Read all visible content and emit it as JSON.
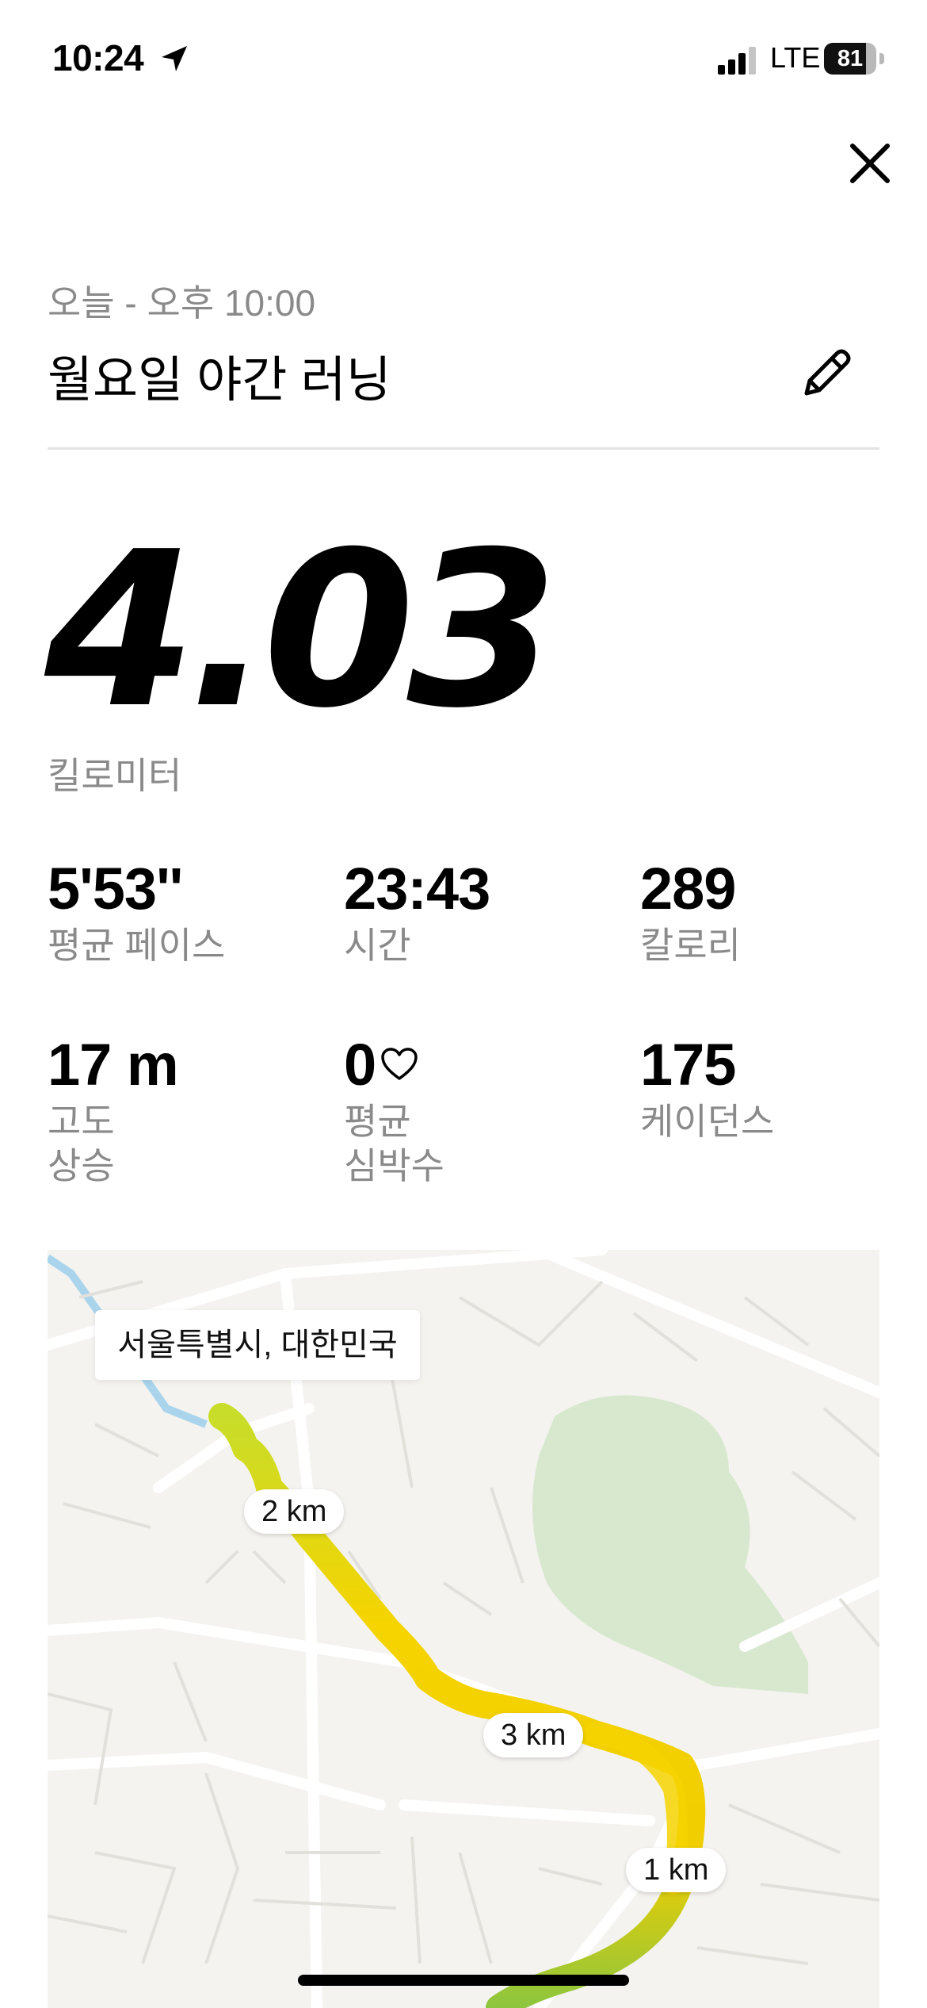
{
  "status_bar": {
    "time": "10:24",
    "network": "LTE",
    "battery_level": 81,
    "battery_text": "81",
    "location_icon": "location-arrow-icon",
    "signal_icon": "cellular-signal-icon"
  },
  "header": {
    "close_icon": "close-icon",
    "date_label": "오늘 - 오후 10:00",
    "title": "월요일 야간 러닝",
    "edit_icon": "pencil-icon"
  },
  "summary": {
    "distance": "4.03",
    "distance_unit": "킬로미터"
  },
  "stats": [
    {
      "value": "5'53''",
      "label": "평균 페이스"
    },
    {
      "value": "23:43",
      "label": "시간"
    },
    {
      "value": "289",
      "label": "칼로리"
    },
    {
      "value": "17 m",
      "label": "고도\n상승"
    },
    {
      "value": "0",
      "label": "평균\n심박수",
      "icon": "heart-outline-icon"
    },
    {
      "value": "175",
      "label": "케이던스"
    }
  ],
  "map": {
    "location": "서울특별시, 대한민국",
    "km_markers": [
      "2 km",
      "3 km",
      "1 km"
    ],
    "route_colors": {
      "start": "#c8dd2a",
      "mid": "#f5d400",
      "end": "#8cc63f"
    },
    "park_color": "#d8e8cf",
    "water_color": "#a9d4ec"
  },
  "colors": {
    "label_gray": "#8a8a8a",
    "divider": "#e3e3e3"
  }
}
